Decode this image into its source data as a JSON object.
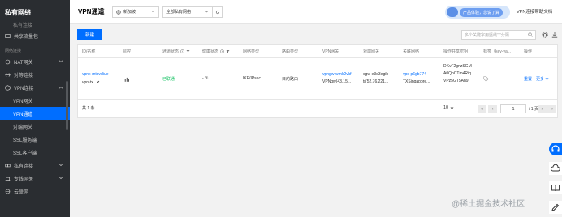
{
  "sidebar": {
    "title": "私有网络",
    "items": [
      {
        "label": "私有连接",
        "type": "faded"
      },
      {
        "label": "共享流量包",
        "type": "item"
      },
      {
        "label": "网络连接",
        "type": "section"
      },
      {
        "label": "NAT网关",
        "type": "expandable"
      },
      {
        "label": "对等连接",
        "type": "item"
      },
      {
        "label": "VPN连接",
        "type": "expanded"
      },
      {
        "label": "VPN网关",
        "type": "sub"
      },
      {
        "label": "VPN通道",
        "type": "sub-active"
      },
      {
        "label": "对端网关",
        "type": "sub"
      },
      {
        "label": "SSL服务端",
        "type": "sub"
      },
      {
        "label": "SSL客户端",
        "type": "sub"
      },
      {
        "label": "私有连接",
        "type": "expandable"
      },
      {
        "label": "专线网关",
        "type": "expandable"
      },
      {
        "label": "云联网",
        "type": "item"
      }
    ]
  },
  "header": {
    "title": "VPN通道",
    "region": "新加坡",
    "vpc": "全部私有网络",
    "toggle_label": "产品体验，您说了算",
    "help": "VPN连接帮助文档"
  },
  "toolbar": {
    "new_button": "新建",
    "search_placeholder": "多个关键字用竖线\"|\"分隔"
  },
  "table": {
    "columns": [
      "ID/名称",
      "监控",
      "通道状态",
      "健康状态",
      "网络类型",
      "路由类型",
      "VPN网关",
      "对端网关",
      "关联网络",
      "操作共享密钥",
      "标签（key-va...",
      "操作"
    ],
    "rows": [
      {
        "id": "vpnx-mtbvdiue",
        "name": "vpn-tx",
        "status": "已联通",
        "health": "- ①",
        "network_type": "IKE/IPsec",
        "route_type": "目的路由",
        "vpn_gw_id": "vpngw-wmk2vkf",
        "vpn_gw_name": "VPNgw(43.15...",
        "peer_gw_id": "cgw-e3q3egih",
        "peer_gw_name": "tr(52.76.221...",
        "vpc_id": "vpc-p6gb774",
        "vpc_name": "TXSingapore...",
        "psk_1": "DKvF2gnzSGM",
        "psk_2": "A0QpCTm4Riq",
        "psk_3": "VPz5GT5Ah9",
        "tag": "",
        "action_reset": "重置",
        "action_more": "更多"
      }
    ],
    "footer": {
      "total": "共 1 条",
      "page_size": "10",
      "page": "1",
      "pages": "/ 1 页"
    }
  },
  "watermark": "@稀土掘金技术社区",
  "colors": {
    "accent": "#006eff",
    "sidebar_bg": "#2a2d31",
    "success": "#0abf5b"
  }
}
